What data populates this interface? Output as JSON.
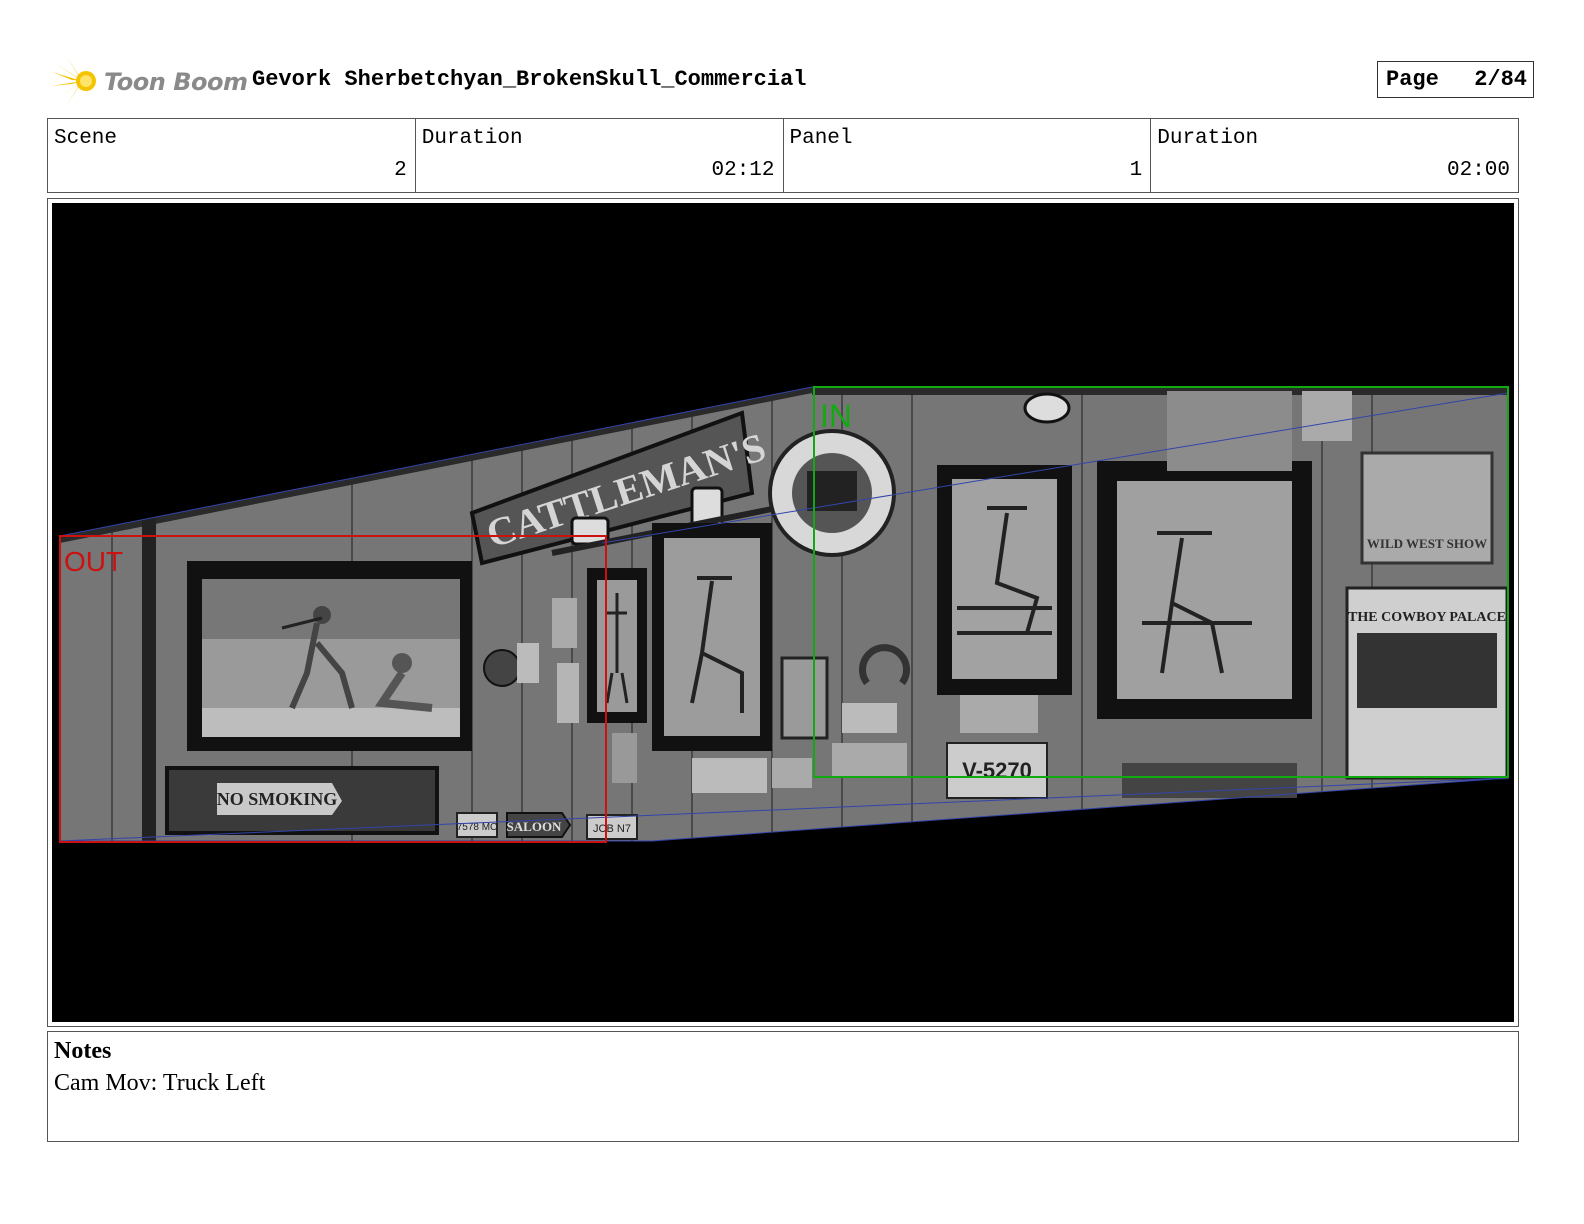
{
  "header": {
    "logo_text": "Toon Boom",
    "logo_icon": "toon-boom-starburst-icon",
    "project_title": "Gevork Sherbetchyan_BrokenSkull_Commercial",
    "page_label": "Page",
    "page_number": "2/84"
  },
  "info": {
    "scene_label": "Scene",
    "scene_value": "2",
    "scene_duration_label": "Duration",
    "scene_duration_value": "02:12",
    "panel_label": "Panel",
    "panel_value": "1",
    "panel_duration_label": "Duration",
    "panel_duration_value": "02:00"
  },
  "panel": {
    "out_label": "OUT",
    "in_label": "IN",
    "out_color": "#cc1111",
    "in_color": "#11aa11",
    "guide_color": "#3344aa",
    "signs": {
      "cattleman": "CATTLEMAN'S",
      "no_smoking": "NO SMOKING",
      "saloon": "SALOON",
      "plate_1": "7578 MC",
      "plate_2": "JCB N7",
      "plate_3": "V-5270",
      "poster": "THE COWBOY PALACE",
      "wild_west": "WILD WEST SHOW"
    }
  },
  "notes": {
    "title": "Notes",
    "body": "Cam Mov: Truck Left"
  }
}
